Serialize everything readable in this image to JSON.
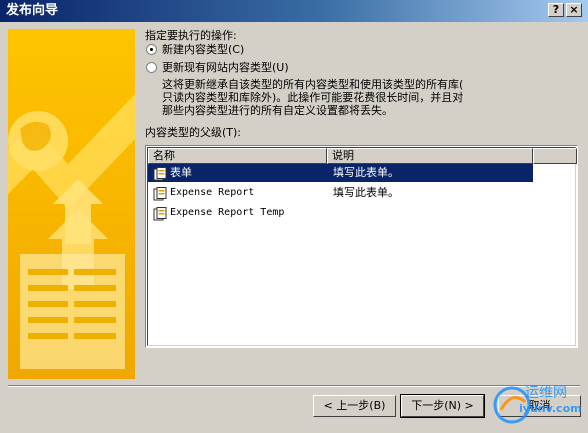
{
  "window": {
    "title": "发布向导"
  },
  "titlebar": {
    "help": "?",
    "close": "×"
  },
  "options": {
    "prompt": "指定要执行的操作:",
    "new_type": "新建内容类型(C)",
    "update_type": "更新现有网站内容类型(U)",
    "update_desc_1": "这将更新继承自该类型的所有内容类型和使用该类型的所有库(",
    "update_desc_2": "只读内容类型和库除外)。此操作可能要花费很长时间，并且对",
    "update_desc_3": "那些内容类型进行的所有自定义设置都将丢失。"
  },
  "parent": {
    "label": "内容类型的父级(T):",
    "columns": [
      "名称",
      "说明"
    ],
    "rows": [
      {
        "name": "表单",
        "desc": "填写此表单。",
        "selected": true
      },
      {
        "name": "Expense Report",
        "desc": "填写此表单。",
        "selected": false
      },
      {
        "name": "Expense Report Temp",
        "desc": "",
        "selected": false
      }
    ]
  },
  "buttons": {
    "back": "< 上一步(B)",
    "next": "下一步(N) >",
    "cancel": "取消"
  },
  "watermark": {
    "cn": "运维网",
    "url": "iyunv.com"
  },
  "colors": {
    "title_start": "#0a246a",
    "title_end": "#a6caf0",
    "selection": "#0a246a",
    "art": "#f5b400"
  }
}
